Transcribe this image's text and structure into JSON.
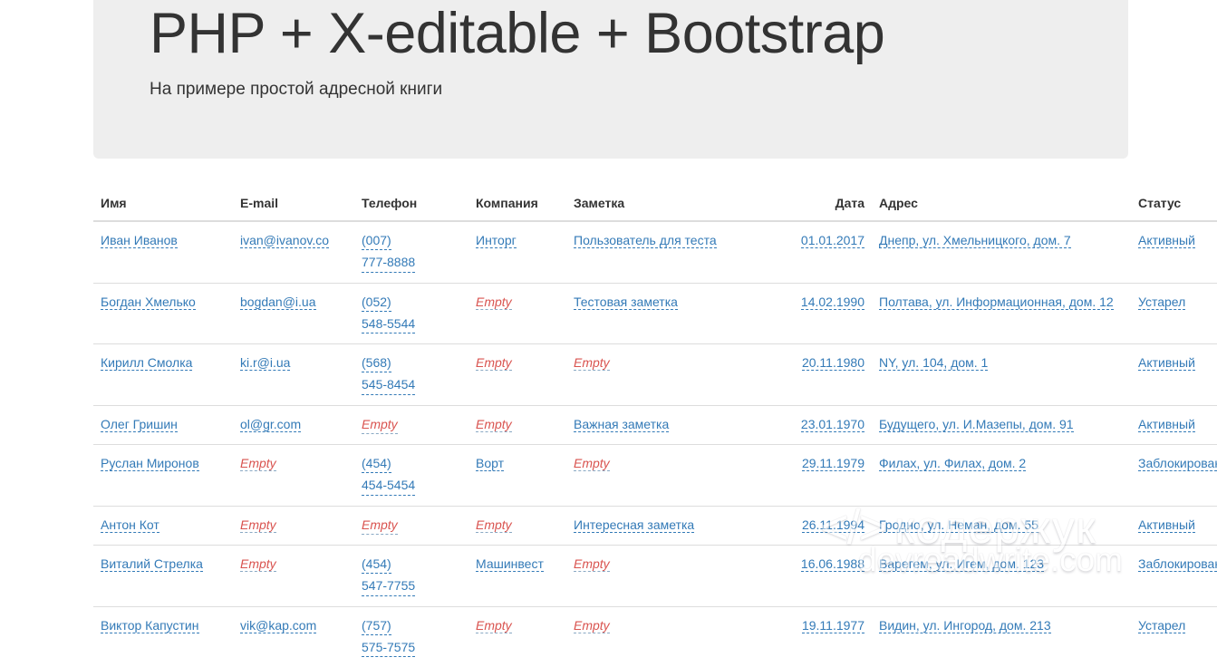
{
  "header": {
    "title": "PHP + X-editable + Bootstrap",
    "subtitle": "На примере простой адресной книги"
  },
  "colors": {
    "link": "#337ab7",
    "empty": "#d9534f",
    "jumbotron_bg": "#eeeeee",
    "text": "#333333",
    "border": "#dddddd"
  },
  "table": {
    "columns": [
      {
        "key": "name",
        "label": "Имя"
      },
      {
        "key": "email",
        "label": "E-mail"
      },
      {
        "key": "phone",
        "label": "Телефон"
      },
      {
        "key": "company",
        "label": "Компания"
      },
      {
        "key": "note",
        "label": "Заметка"
      },
      {
        "key": "date",
        "label": "Дата"
      },
      {
        "key": "address",
        "label": "Адрес"
      },
      {
        "key": "status",
        "label": "Статус"
      }
    ],
    "empty_label": "Empty",
    "rows": [
      {
        "name": "Иван Иванов",
        "email": "ivan@ivanov.co",
        "phone_line1": "(007)",
        "phone_line2": "777-8888",
        "company": "Инторг",
        "note": "Пользователь для теста",
        "date": "01.01.2017",
        "address": "Днепр, ул. Хмельницкого, дом. 7",
        "status": "Активный"
      },
      {
        "name": "Богдан Хмелько",
        "email": "bogdan@i.ua",
        "phone_line1": "(052)",
        "phone_line2": "548-5544",
        "company": "Empty",
        "note": "Тестовая заметка",
        "date": "14.02.1990",
        "address": "Полтава, ул. Информационная, дом. 12",
        "status": "Устарел"
      },
      {
        "name": "Кирилл Смолка",
        "email": "ki.r@i.ua",
        "phone_line1": "(568)",
        "phone_line2": "545-8454",
        "company": "Empty",
        "note": "Empty",
        "date": "20.11.1980",
        "address": "NY, ул. 104, дом. 1",
        "status": "Активный"
      },
      {
        "name": "Олег Гришин",
        "email": "ol@gr.com",
        "phone_line1": "Empty",
        "phone_line2": "",
        "company": "Empty",
        "note": "Важная заметка",
        "date": "23.01.1970",
        "address": "Будущего, ул. И.Мазепы, дом. 91",
        "status": "Активный"
      },
      {
        "name": "Руслан Миронов",
        "email": "Empty",
        "phone_line1": "(454)",
        "phone_line2": "454-5454",
        "company": "Ворт",
        "note": "Empty",
        "date": "29.11.1979",
        "address": "Филах, ул. Филах, дом. 2",
        "status": "Заблокирован"
      },
      {
        "name": "Антон Кот",
        "email": "Empty",
        "phone_line1": "Empty",
        "phone_line2": "",
        "company": "Empty",
        "note": "Интересная заметка",
        "date": "26.11.1994",
        "address": "Гродно, ул. Неман, дом. 55",
        "status": "Активный"
      },
      {
        "name": "Виталий Стрелка",
        "email": "Empty",
        "phone_line1": "(454)",
        "phone_line2": "547-7755",
        "company": "Машинвест",
        "note": "Empty",
        "date": "16.06.1988",
        "address": "Варегем, ул. Игем, дом. 123",
        "status": "Заблокирован"
      },
      {
        "name": "Виктор Капустин",
        "email": "vik@kap.com",
        "phone_line1": "(757)",
        "phone_line2": "575-7575",
        "company": "Empty",
        "note": "Empty",
        "date": "19.11.1977",
        "address": "Видин, ул. Ингород, дом. 213",
        "status": "Устарел"
      }
    ]
  },
  "watermark": {
    "code_glyph": "</>",
    "brand": "кодержук",
    "domain": "devreadwrite.com"
  }
}
